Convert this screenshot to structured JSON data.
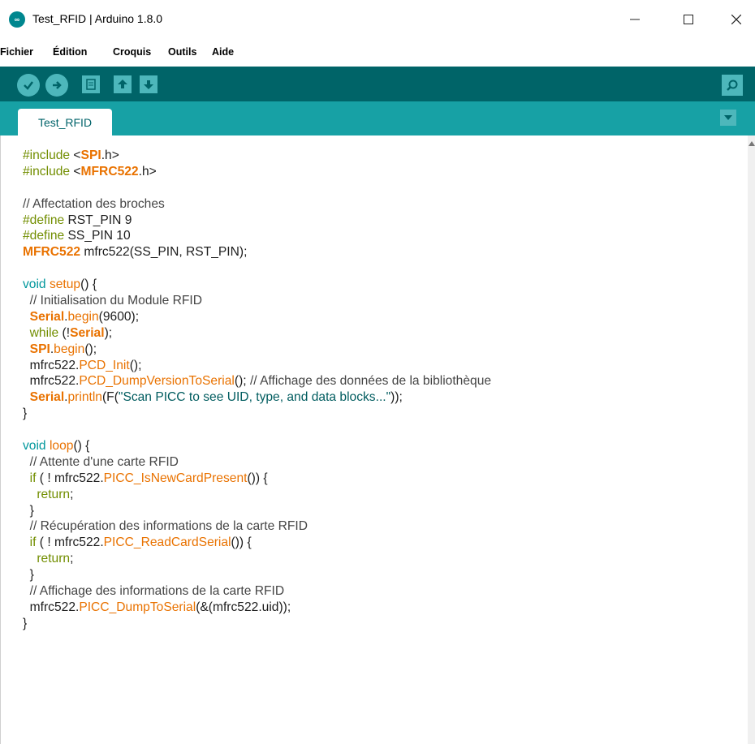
{
  "window": {
    "icon_text": "∞",
    "title": "Test_RFID | Arduino 1.8.0"
  },
  "menu": [
    "Fichier",
    "Édition",
    "Croquis",
    "Outils",
    "Aide"
  ],
  "toolbar": {
    "buttons": [
      "verify-icon",
      "upload-icon",
      "new-icon",
      "open-icon",
      "save-icon",
      "serial-monitor-icon"
    ]
  },
  "tabs": [
    {
      "label": "Test_RFID"
    }
  ],
  "colors": {
    "toolbar_bg": "#006468",
    "tabbar_bg": "#17a1a5",
    "button_bg": "#4db7bb",
    "keyword": "#728e00",
    "library": "#e97200",
    "comment": "#444444"
  },
  "code": [
    "#include <SPI.h>",
    "#include <MFRC522.h>",
    "",
    "// Affectation des broches",
    "#define RST_PIN 9",
    "#define SS_PIN 10",
    "MFRC522 mfrc522(SS_PIN, RST_PIN);",
    "",
    "void setup() {",
    "  // Initialisation du Module RFID",
    "  Serial.begin(9600);",
    "  while (!Serial);",
    "  SPI.begin();",
    "  mfrc522.PCD_Init();",
    "  mfrc522.PCD_DumpVersionToSerial(); // Affichage des données de la bibliothèque",
    "  Serial.println(F(\"Scan PICC to see UID, type, and data blocks...\"));",
    "}",
    "",
    "void loop() {",
    "  // Attente d'une carte RFID",
    "  if ( ! mfrc522.PICC_IsNewCardPresent()) {",
    "    return;",
    "  }",
    "  // Récupération des informations de la carte RFID",
    "  if ( ! mfrc522.PICC_ReadCardSerial()) {",
    "    return;",
    "  }",
    "  // Affichage des informations de la carte RFID",
    "  mfrc522.PICC_DumpToSerial(&(mfrc522.uid));",
    "}"
  ]
}
